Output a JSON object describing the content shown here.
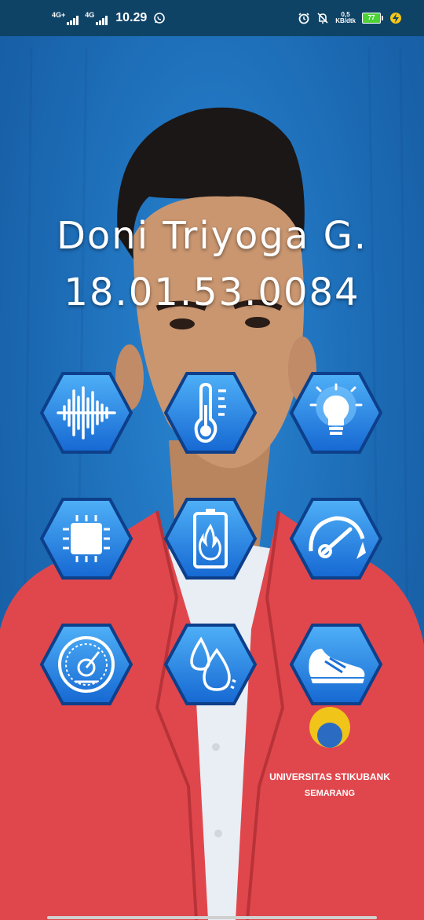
{
  "status_bar": {
    "network_1": "4G+",
    "network_2": "4G",
    "time": "10.29",
    "whatsapp_icon": "whatsapp-icon",
    "alarm_icon": "alarm-icon",
    "mute_icon": "notifications-off-icon",
    "speed_value": "0,5",
    "speed_unit": "KB/dtk",
    "battery_level": "77",
    "charging_icon": "charging-bolt-icon"
  },
  "profile": {
    "name": "Doni Triyoga G.",
    "id": "18.01.53.0084"
  },
  "background": {
    "description_icon": "profile-photo",
    "shirt_text_1": "UNIVERSITAS STIKUBANK",
    "shirt_text_2": "SEMARANG"
  },
  "sensors": [
    {
      "icon": "sound-wave-icon"
    },
    {
      "icon": "thermometer-icon"
    },
    {
      "icon": "light-bulb-icon"
    },
    {
      "icon": "processor-chip-icon"
    },
    {
      "icon": "battery-heat-icon"
    },
    {
      "icon": "speedometer-icon"
    },
    {
      "icon": "pressure-gauge-icon"
    },
    {
      "icon": "humidity-drops-icon"
    },
    {
      "icon": "running-shoe-icon"
    }
  ],
  "colors": {
    "hex_fill_top": "#4aa9f5",
    "hex_fill_bottom": "#1a6fd6",
    "hex_border": "#0d3f8a",
    "status_bar": "#0f4366",
    "jacket": "#e0474c"
  }
}
